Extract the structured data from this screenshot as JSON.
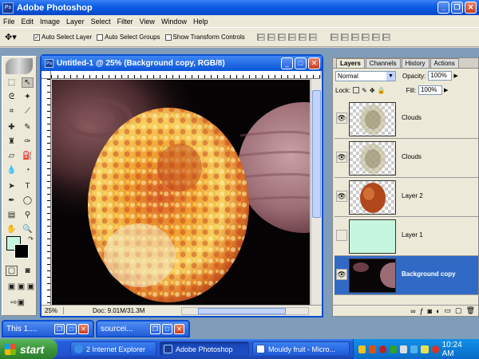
{
  "app": {
    "window_title": "Adobe Photoshop",
    "logo_text": "Ps"
  },
  "menu": [
    "File",
    "Edit",
    "Image",
    "Layer",
    "Select",
    "Filter",
    "View",
    "Window",
    "Help"
  ],
  "options_bar": {
    "auto_select_layer": "Auto Select Layer",
    "auto_select_groups": "Auto Select Groups",
    "show_transform_controls": "Show Transform Controls"
  },
  "document": {
    "title": "Untitled-1 @ 25% (Background copy, RGB/8)",
    "zoom": "25%",
    "doc_size": "Doc: 9.01M/31.3M"
  },
  "layers_palette": {
    "tabs": [
      "Layers",
      "Channels",
      "History",
      "Actions"
    ],
    "blend_mode": "Normal",
    "opacity_label": "Opacity:",
    "opacity_value": "100%",
    "lock_label": "Lock:",
    "fill_label": "Fill:",
    "fill_value": "100%",
    "layers": [
      {
        "name": "Clouds",
        "visible": true,
        "selected": false
      },
      {
        "name": "Clouds",
        "visible": true,
        "selected": false
      },
      {
        "name": "Layer 2",
        "visible": true,
        "selected": false
      },
      {
        "name": "Layer 1",
        "visible": false,
        "selected": false
      },
      {
        "name": "Background copy",
        "visible": true,
        "selected": true
      }
    ]
  },
  "minimized_windows": [
    {
      "title": "This 1...."
    },
    {
      "title": "sourcei..."
    }
  ],
  "taskbar": {
    "start_label": "start",
    "tasks": [
      {
        "label": "2 Internet Explorer",
        "icon": "internet-explorer-icon"
      },
      {
        "label": "Adobe Photoshop",
        "icon": "photoshop-icon"
      },
      {
        "label": "Mouldy fruit - Micro...",
        "icon": "word-icon"
      }
    ],
    "clock": "10:24 AM"
  },
  "colors": {
    "xp_blue": "#0a5ce4",
    "selection_blue": "#316ac5",
    "foreground_color": "#c6f6e0",
    "background_color": "#000000",
    "layer1_fill": "#c6f6e0"
  }
}
